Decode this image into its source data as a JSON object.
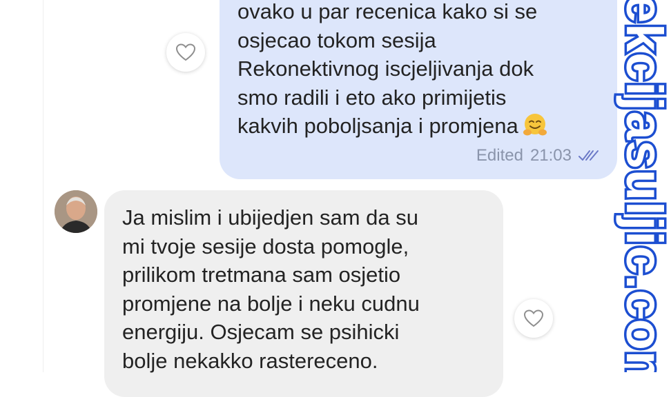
{
  "outgoing_message": {
    "lines": [
      "ovako u par recenica kako si se",
      "osjecao tokom sesija",
      "Rekonektivnog iscjeljivanja dok",
      "smo radili i eto ako primijetis",
      "kakvih poboljsanja i promjena"
    ],
    "emoji": "hugging-face-emoji",
    "edited_label": "Edited",
    "time": "21:03",
    "status_icon": "double-check-icon",
    "bubble_color": "#dde6fb"
  },
  "incoming_message": {
    "lines": [
      "Ja mislim i ubijedjen sam da su",
      "mi tvoje sesije dosta pomogle,",
      "prilikom tretmana sam osjetio",
      "promjene na bolje i neku cudnu",
      "energiju. Osjecam se psihicki",
      "bolje nekakko rastereceno."
    ],
    "bubble_color": "#efefef"
  },
  "reactions": {
    "icon": "heart-outline-icon"
  },
  "watermark": {
    "text": "ekcijasuljic.com",
    "color": "#1d4fd1"
  }
}
